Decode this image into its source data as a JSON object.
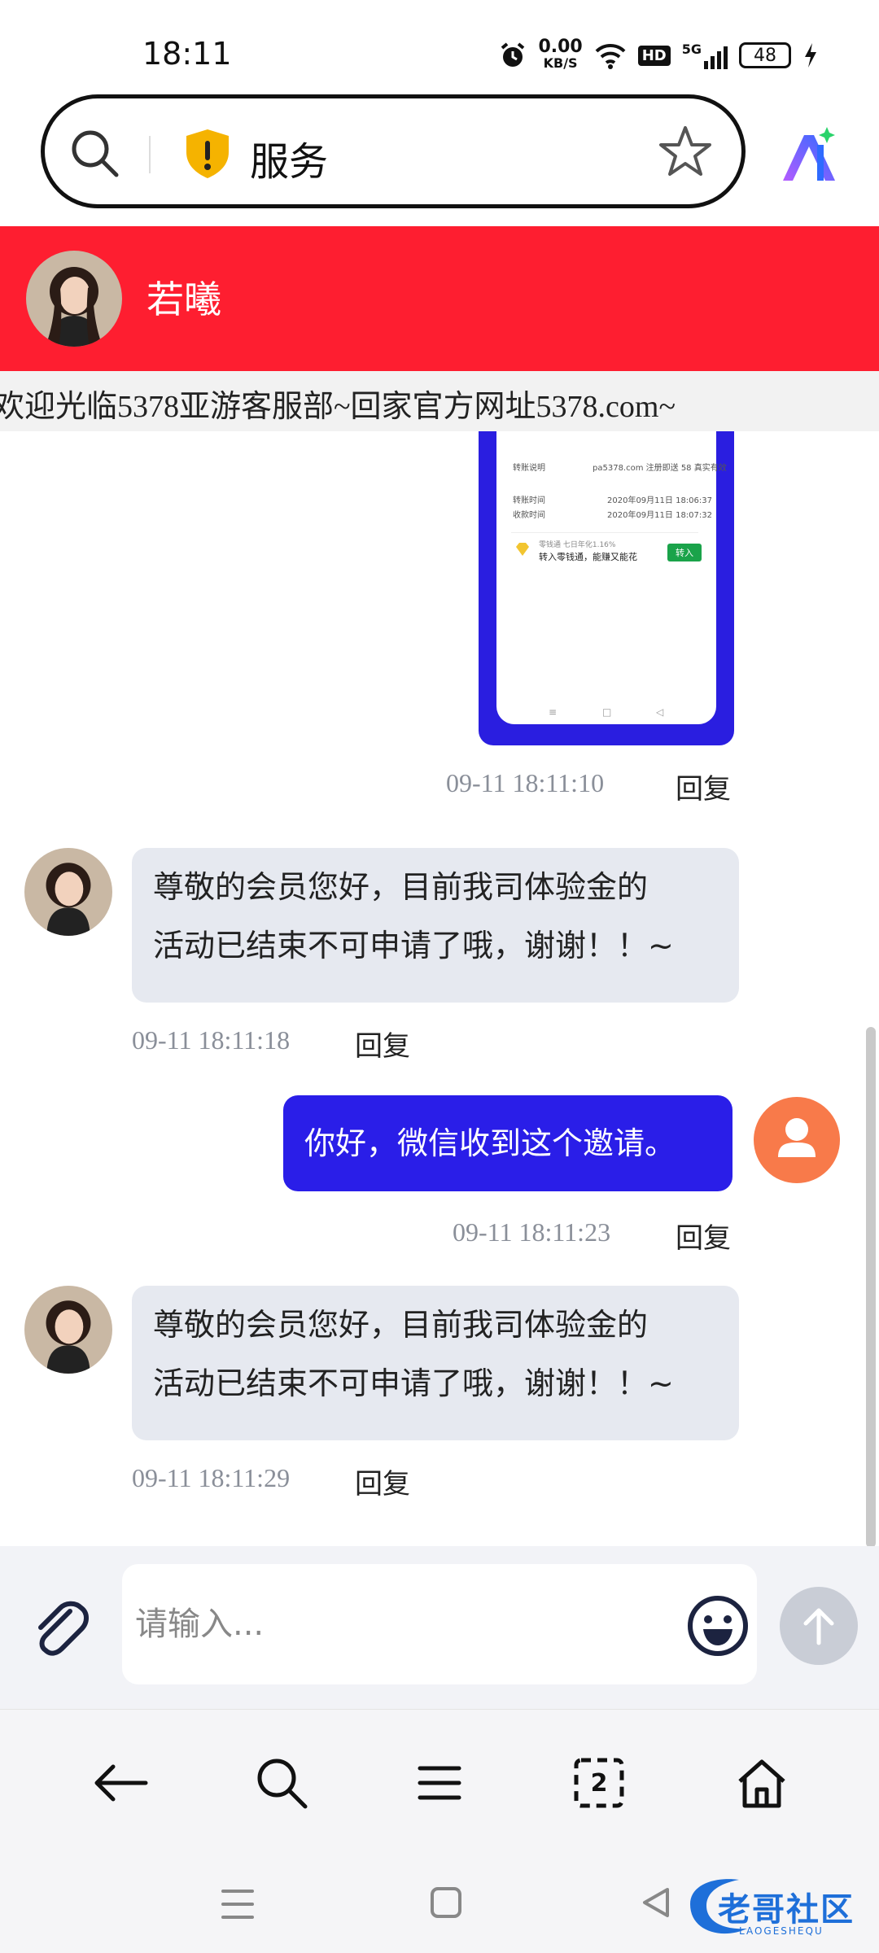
{
  "status_bar": {
    "time": "18:11",
    "net_speed": "0.00",
    "net_unit": "KB/S",
    "hd": "HD",
    "signal": "5G",
    "battery": "48"
  },
  "address_bar": {
    "title": "服务"
  },
  "chat_header": {
    "name": "若曦"
  },
  "marquee": {
    "text": "欢迎光临5378亚游客服部~回家官方网址5378.com~"
  },
  "image_message": {
    "row1_label": "转账说明",
    "row1_value": "pa5378.com 注册即送 58 真实有效",
    "row2_label": "转账时间",
    "row2_value": "2020年09月11日 18:06:37",
    "row3_label": "收款时间",
    "row3_value": "2020年09月11日 18:07:32",
    "promo_line1": "零钱通 七日年化1.16%",
    "promo_line2": "转入零钱通，能赚又能花",
    "promo_button": "转入",
    "timestamp": "09-11 18:11:10",
    "reply": "回复"
  },
  "messages": [
    {
      "side": "left",
      "line1": "尊敬的会员您好，目前我司体验金的",
      "line2": "活动已结束不可申请了哦，谢谢！！~",
      "timestamp": "09-11 18:11:18",
      "reply": "回复"
    },
    {
      "side": "right",
      "line1": "你好，微信收到这个邀请。",
      "timestamp": "09-11 18:11:23",
      "reply": "回复"
    },
    {
      "side": "left",
      "line1": "尊敬的会员您好，目前我司体验金的",
      "line2": "活动已结束不可申请了哦，谢谢！！~",
      "timestamp": "09-11 18:11:29",
      "reply": "回复"
    }
  ],
  "input": {
    "placeholder": "请输入..."
  },
  "browser_nav": {
    "tabs_count": "2"
  },
  "watermark": {
    "text": "老哥社区",
    "subtext": "LAOGESHEQU"
  },
  "colors": {
    "header_red": "#fe1e30",
    "bubble_blue": "#2a1ee8",
    "bubble_grey": "#e6e9f0",
    "user_avatar_orange": "#f87a4a"
  }
}
